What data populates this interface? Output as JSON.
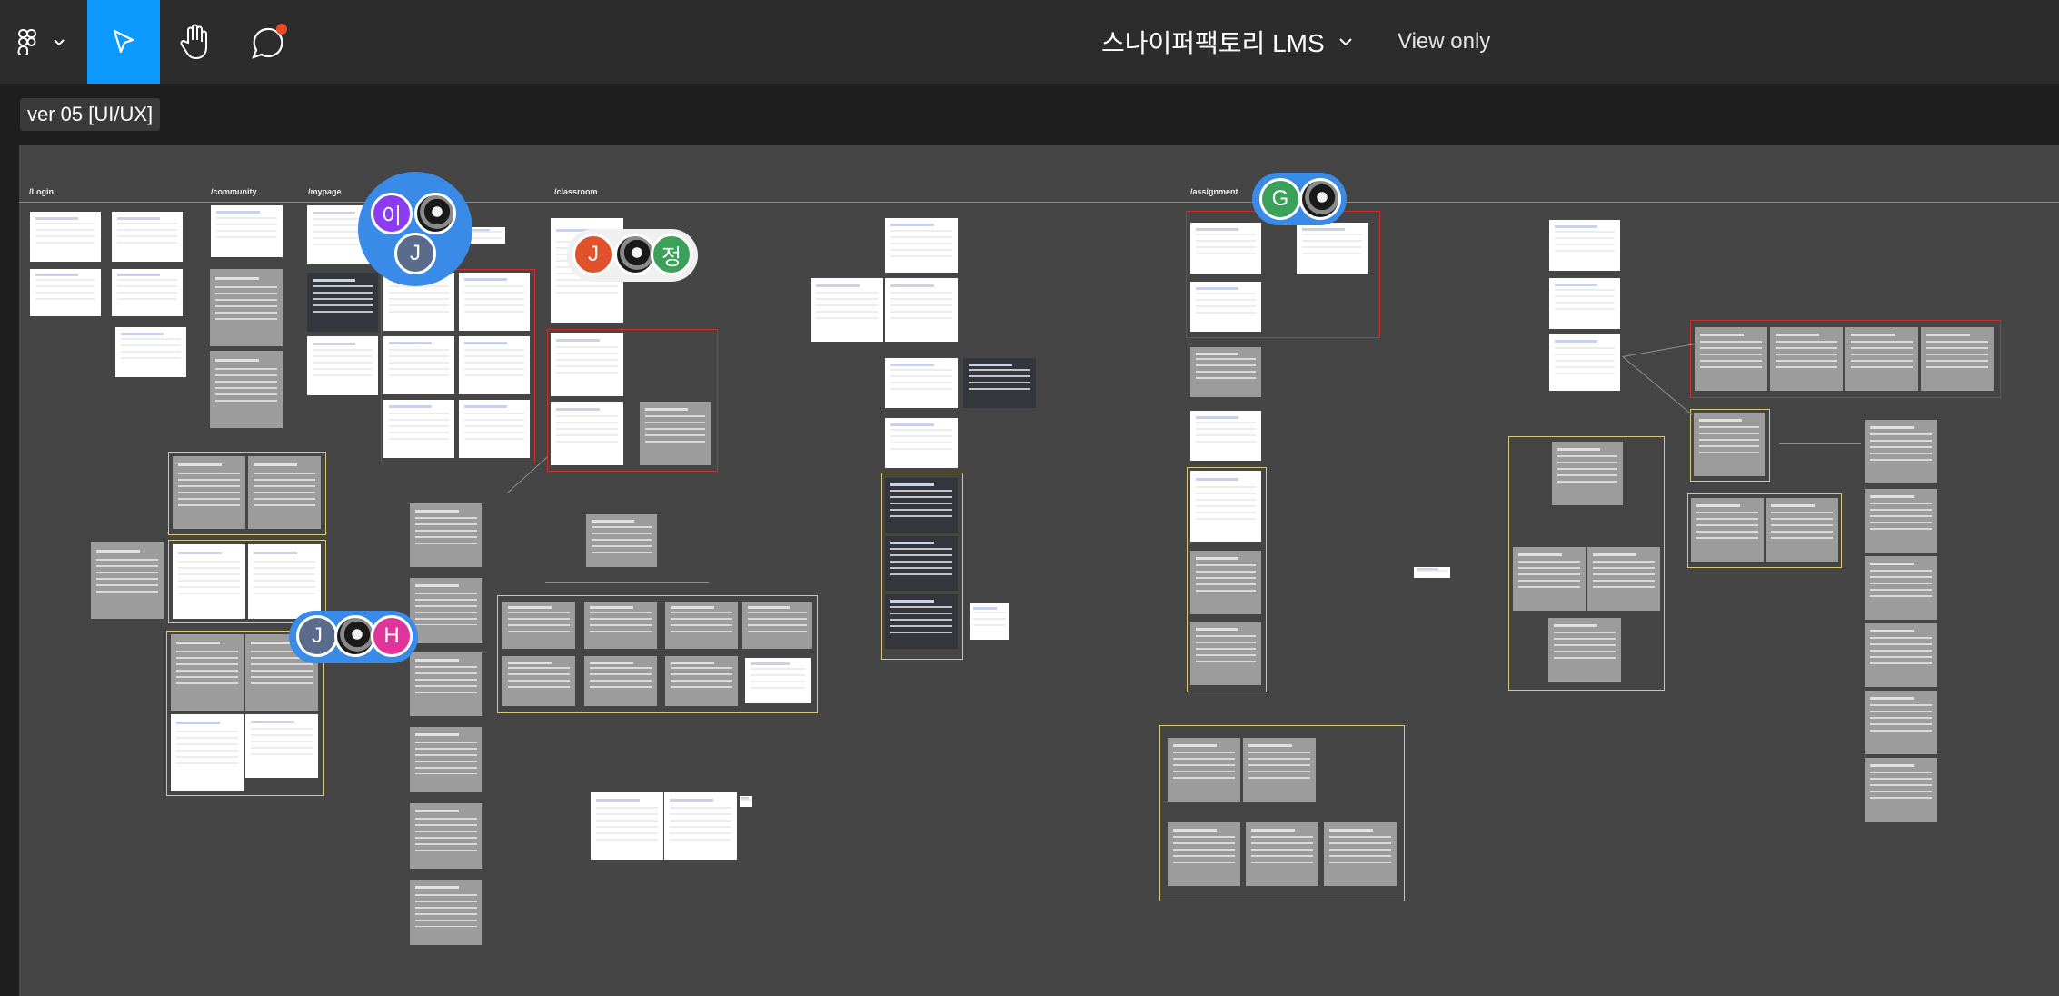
{
  "toolbar": {
    "file_title": "스나이퍼팩토리 LMS",
    "view_only": "View only",
    "tools": [
      "figma-menu-icon",
      "move-tool-icon",
      "hand-tool-icon",
      "comment-icon"
    ],
    "accent": "#0d99ff",
    "notification_color": "#f24822"
  },
  "page": {
    "name": "ver 05 [UI/UX]"
  },
  "canvas": {
    "sections": [
      "/Login",
      "/community",
      "/mypage",
      "/classroom",
      "/assignment"
    ]
  },
  "collaborators": {
    "group1": [
      "이",
      "J"
    ],
    "group2": [
      "J",
      "정"
    ],
    "group3": [
      "J",
      "H"
    ],
    "group4": [
      "G"
    ]
  }
}
